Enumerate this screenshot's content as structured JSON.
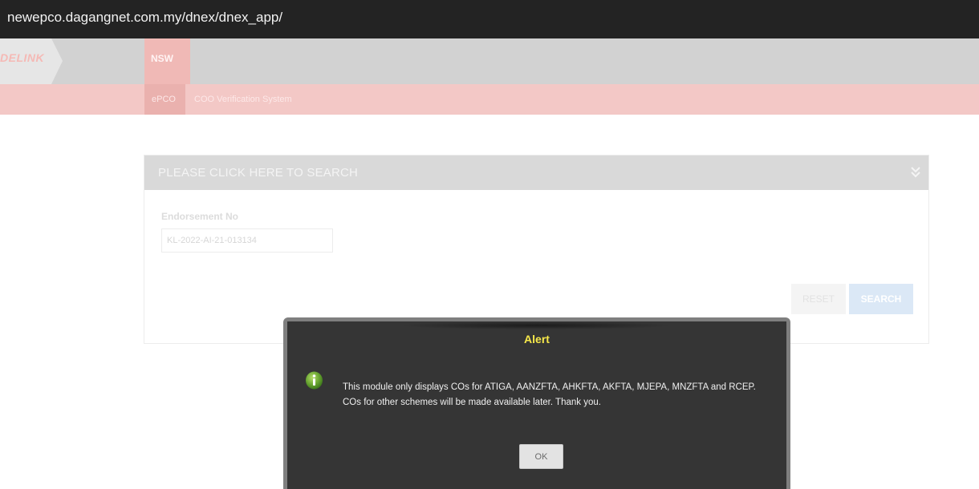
{
  "browser": {
    "url": "newepco.dagangnet.com.my/dnex/dnex_app/"
  },
  "nav": {
    "logo_text": "DELINK",
    "nsw_tab": "NSW",
    "epco_tab": "ePCO",
    "system_title": "COO Verification System"
  },
  "search_panel": {
    "header": "PLEASE CLICK HERE TO SEARCH",
    "field_label": "Endorsement No",
    "field_value": "KL-2022-AI-21-013134",
    "reset_label": "RESET",
    "search_label": "SEARCH"
  },
  "alert": {
    "title": "Alert",
    "line1": "This module only displays COs for ATIGA, AANZFTA, AHKFTA, AKFTA, MJEPA, MNZFTA and RCEP.",
    "line2": "COs for other schemes will be made available later. Thank you.",
    "ok_label": "OK",
    "icon": "info-icon"
  },
  "colors": {
    "title_yellow": "#f6e84a",
    "dialog_bg": "#353535",
    "subnav_pink": "#f3c8c6"
  }
}
